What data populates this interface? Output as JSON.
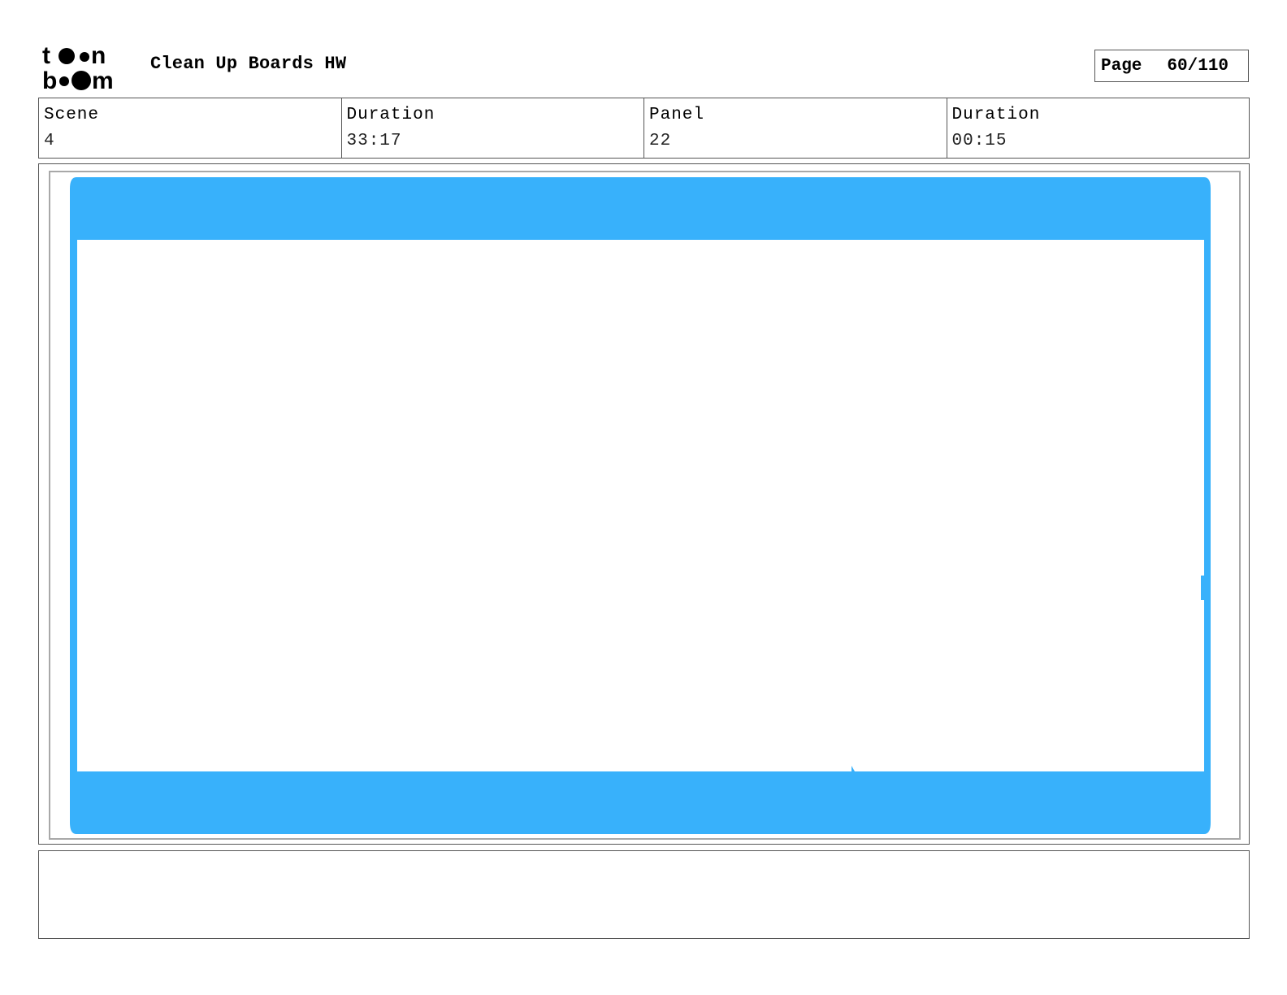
{
  "header": {
    "logo_text": "toon boom",
    "title": "Clean Up Boards HW",
    "page_label": "Page",
    "page_value": "60/110"
  },
  "info": {
    "scene_label": "Scene",
    "scene_value": "4",
    "scene_duration_label": "Duration",
    "scene_duration_value": "33:17",
    "panel_label": "Panel",
    "panel_value": "22",
    "panel_duration_label": "Duration",
    "panel_duration_value": "00:15"
  },
  "panel": {
    "frame_color": "#38b1fb",
    "background_color": "#ffffff"
  },
  "notes": {
    "text": ""
  }
}
